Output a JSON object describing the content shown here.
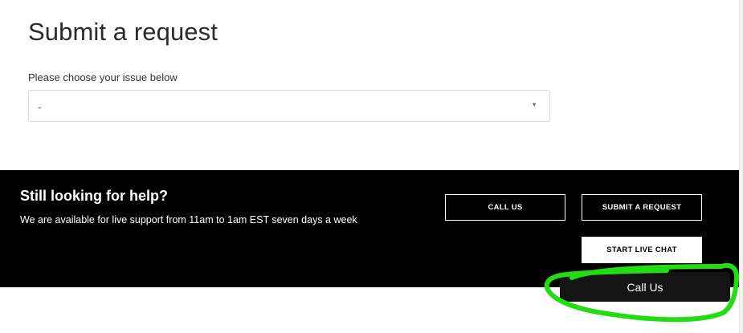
{
  "page": {
    "title": "Submit a request"
  },
  "form": {
    "issue_label": "Please choose your issue below",
    "issue_select": {
      "selected_value": "-",
      "caret_icon": "caret-down-icon"
    }
  },
  "help_band": {
    "title": "Still looking for help?",
    "subtitle": "We are available for live support from 11am to 1am EST seven days a week",
    "call_label": "CALL US",
    "submit_label": "SUBMIT A REQUEST",
    "chat_label": "START LIVE CHAT"
  },
  "floating_widget": {
    "label": "Call Us"
  },
  "annotation": {
    "color": "#22dd11",
    "icon": "hand-drawn-highlight-circle"
  },
  "colors": {
    "band_background": "#000000",
    "floating_button_background": "#141414"
  }
}
